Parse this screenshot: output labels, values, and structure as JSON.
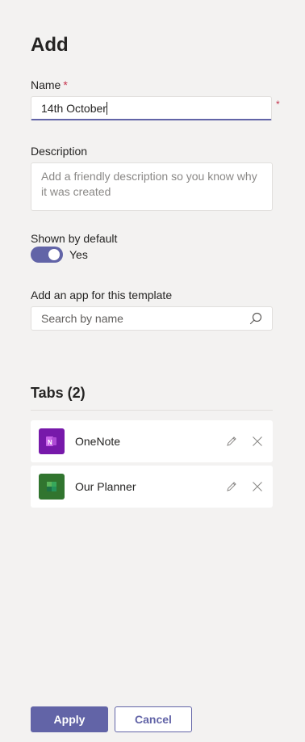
{
  "header": {
    "title": "Add"
  },
  "name_field": {
    "label": "Name",
    "required_mark": "*",
    "value": "14th October"
  },
  "description_field": {
    "label": "Description",
    "placeholder": "Add a friendly description so you know why it was created"
  },
  "shown_by_default": {
    "label": "Shown by default",
    "state_text": "Yes",
    "on": true
  },
  "app_search": {
    "label": "Add an app for this template",
    "placeholder": "Search by name"
  },
  "tabs": {
    "title": "Tabs (2)",
    "items": [
      {
        "name": "OneNote",
        "icon": "onenote-icon",
        "color": "#7719aa"
      },
      {
        "name": "Our Planner",
        "icon": "planner-icon",
        "color": "#31752f"
      }
    ]
  },
  "footer": {
    "apply_label": "Apply",
    "cancel_label": "Cancel"
  },
  "colors": {
    "accent": "#6264a7",
    "required": "#c4314b",
    "background": "#f3f2f1"
  }
}
